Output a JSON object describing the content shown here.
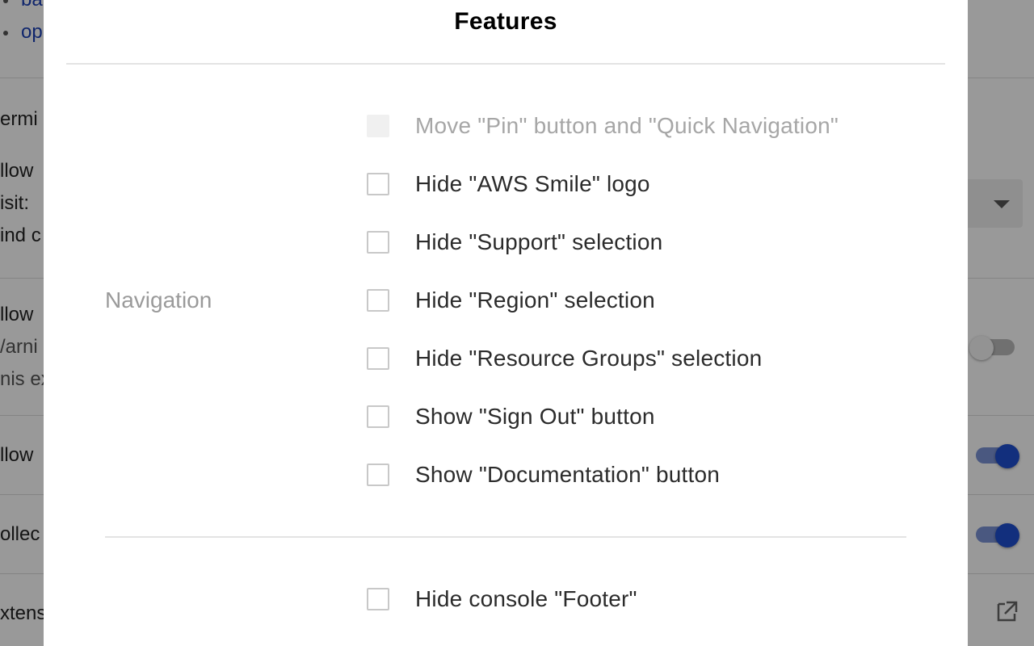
{
  "background": {
    "bullets": [
      "ba",
      "op"
    ],
    "left_fragments": [
      "ermi",
      "llow",
      "isit:",
      "ind c",
      "llow",
      "/arni",
      "nis ex",
      "llow",
      "ollec",
      "xtens"
    ]
  },
  "dialog": {
    "title": "Features",
    "sections": [
      {
        "label": "Navigation",
        "options": [
          {
            "label": "Move \"Pin\" button and \"Quick Navigation\"",
            "checked": false,
            "disabled": true
          },
          {
            "label": "Hide \"AWS Smile\" logo",
            "checked": false,
            "disabled": false
          },
          {
            "label": "Hide \"Support\" selection",
            "checked": false,
            "disabled": false
          },
          {
            "label": "Hide \"Region\" selection",
            "checked": false,
            "disabled": false
          },
          {
            "label": "Hide \"Resource Groups\" selection",
            "checked": false,
            "disabled": false
          },
          {
            "label": "Show \"Sign Out\" button",
            "checked": false,
            "disabled": false
          },
          {
            "label": "Show \"Documentation\" button",
            "checked": false,
            "disabled": false
          }
        ]
      },
      {
        "label": "",
        "options": [
          {
            "label": "Hide console \"Footer\"",
            "checked": false,
            "disabled": false
          }
        ]
      }
    ]
  },
  "colors": {
    "toggle_on": "#1f4fd0",
    "link": "#1a3fb5",
    "overlay": "rgba(0,0,0,0.40)"
  }
}
